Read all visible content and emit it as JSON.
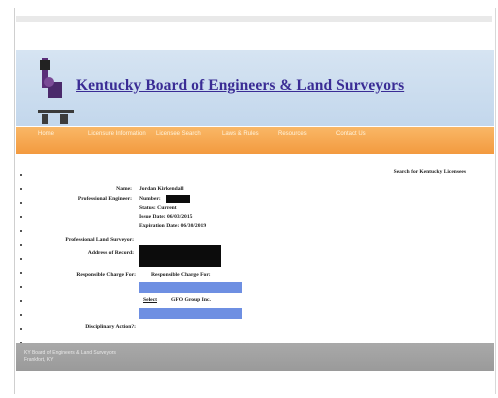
{
  "header": {
    "title": "Kentucky Board of Engineers & Land Surveyors"
  },
  "nav": {
    "items": [
      {
        "label": "Home"
      },
      {
        "label": "Licensure Information"
      },
      {
        "label": "Licensee Search"
      },
      {
        "label": "Laws & Rules"
      },
      {
        "label": "Resources"
      },
      {
        "label": "Contact Us"
      }
    ]
  },
  "search_link": "Search for Kentucky Licensees",
  "licensee": {
    "name_label": "Name:",
    "name_value": "Jordan Kirkendall",
    "pe_label": "Professional Engineer:",
    "number_label": "Number:",
    "status_label": "Status: Current",
    "issue_label": "Issue Date: 06/03/2015",
    "expiration_label": "Expiration Date: 06/30/2019",
    "pls_label": "Professional Land Surveyor:",
    "address_label": "Address of Record:",
    "rcf_label": "Responsible Charge For:",
    "rcf_header": "Responsible Charge For:",
    "select_label": "Select",
    "firm_name": "GFO Group Inc.",
    "disciplinary_label": "Disciplinary Action?:"
  },
  "footer": {
    "line1": "KY Board of Engineers & Land Surveyors",
    "line2": "Frankfort, KY"
  },
  "colors": {
    "banner": "#c9dbee",
    "title": "#3a2c95",
    "nav": "#f5a44b",
    "button": "#6e8fe2",
    "footer": "#a3a3a3"
  }
}
